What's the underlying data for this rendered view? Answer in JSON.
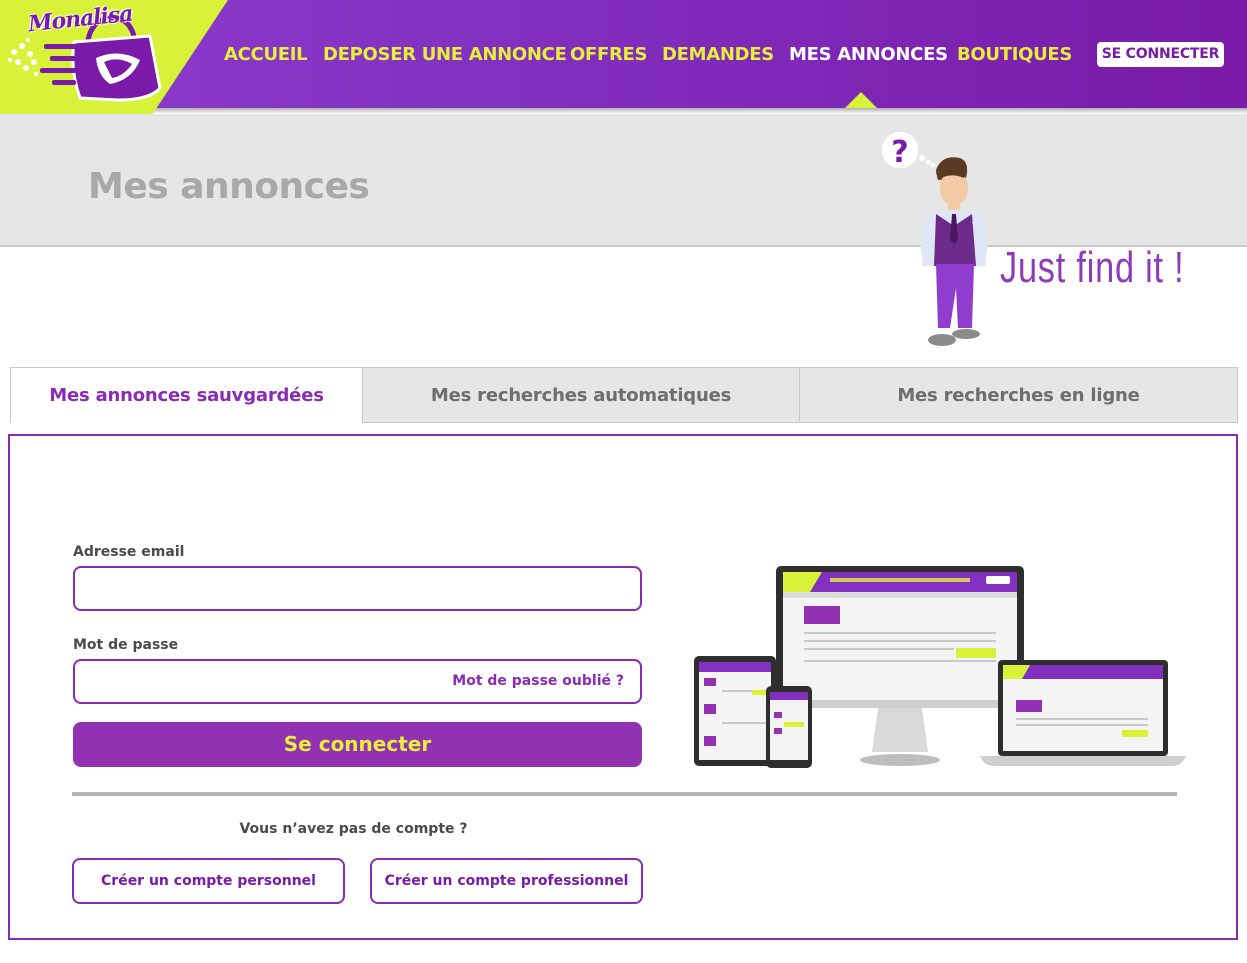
{
  "brand": {
    "logo_text": "Monalisa"
  },
  "nav": {
    "items": [
      {
        "label": "ACCUEIL"
      },
      {
        "label": "DEPOSER UNE ANNONCE"
      },
      {
        "label": "OFFRES"
      },
      {
        "label": "DEMANDES"
      },
      {
        "label": "MES ANNONCES",
        "active": true
      },
      {
        "label": "BOUTIQUES"
      }
    ],
    "connect_label": "SE CONNECTER"
  },
  "banner": {
    "title": "Mes annonces",
    "tagline": "Just find it !",
    "question_mark": "?"
  },
  "tabs": [
    {
      "label": "Mes annonces sauvgardées",
      "active": true
    },
    {
      "label": "Mes recherches automatiques"
    },
    {
      "label": "Mes recherches en ligne"
    }
  ],
  "login": {
    "email_label": "Adresse email",
    "email_value": "",
    "password_label": "Mot de passe",
    "password_value": "",
    "forgot_label": "Mot de passe oublié ?",
    "submit_label": "Se connecter",
    "no_account_text": "Vous n’avez pas de compte ?",
    "create_personal_label": "Créer un compte personnel",
    "create_pro_label": "Créer un compte professionnel"
  },
  "colors": {
    "primary": "#8a2bb5",
    "accent": "#d7f238",
    "nav_text": "#e6ef3a",
    "band_grey": "#e6e6e6"
  }
}
